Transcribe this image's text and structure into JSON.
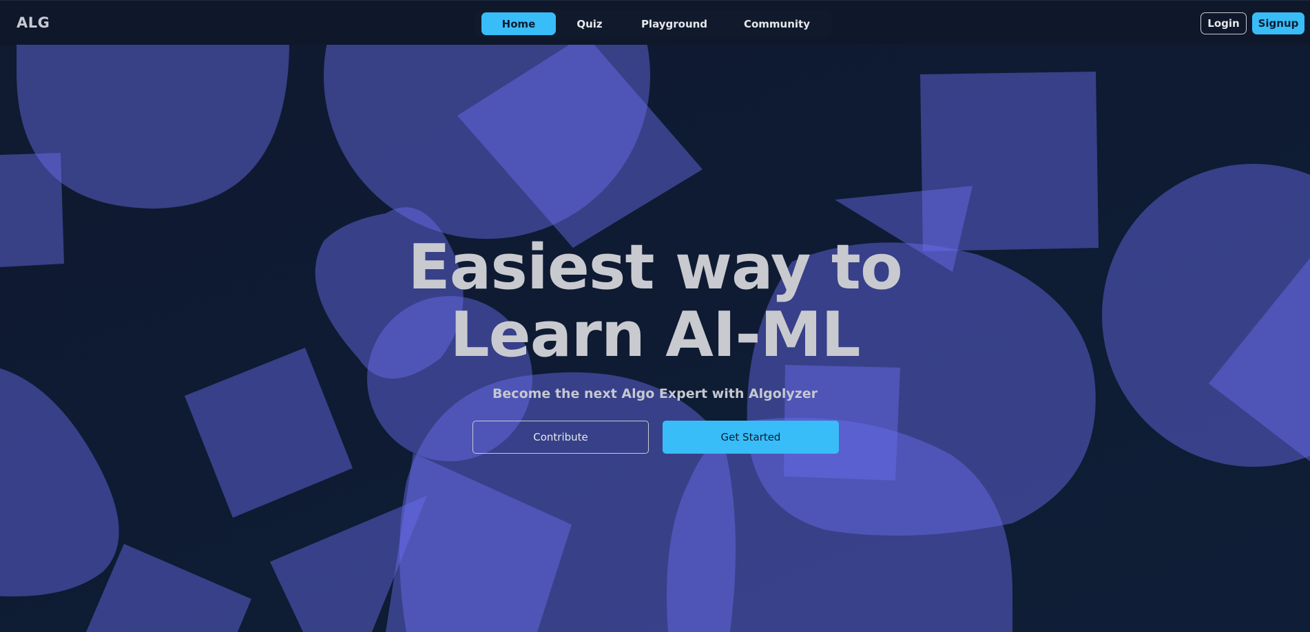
{
  "header": {
    "brand": "ALG",
    "nav": [
      {
        "label": "Home",
        "active": true
      },
      {
        "label": "Quiz",
        "active": false
      },
      {
        "label": "Playground",
        "active": false
      },
      {
        "label": "Community",
        "active": false
      }
    ],
    "login_label": "Login",
    "signup_label": "Signup"
  },
  "hero": {
    "title_line1": "Easiest way to",
    "title_line2": "Learn AI-ML",
    "subtitle": "Become the next Algo Expert with Algolyzer",
    "contribute_label": "Contribute",
    "get_started_label": "Get Started"
  },
  "colors": {
    "accent": "#38bdf8",
    "background": "#0f172a",
    "shape_fill": "#6366f1"
  }
}
